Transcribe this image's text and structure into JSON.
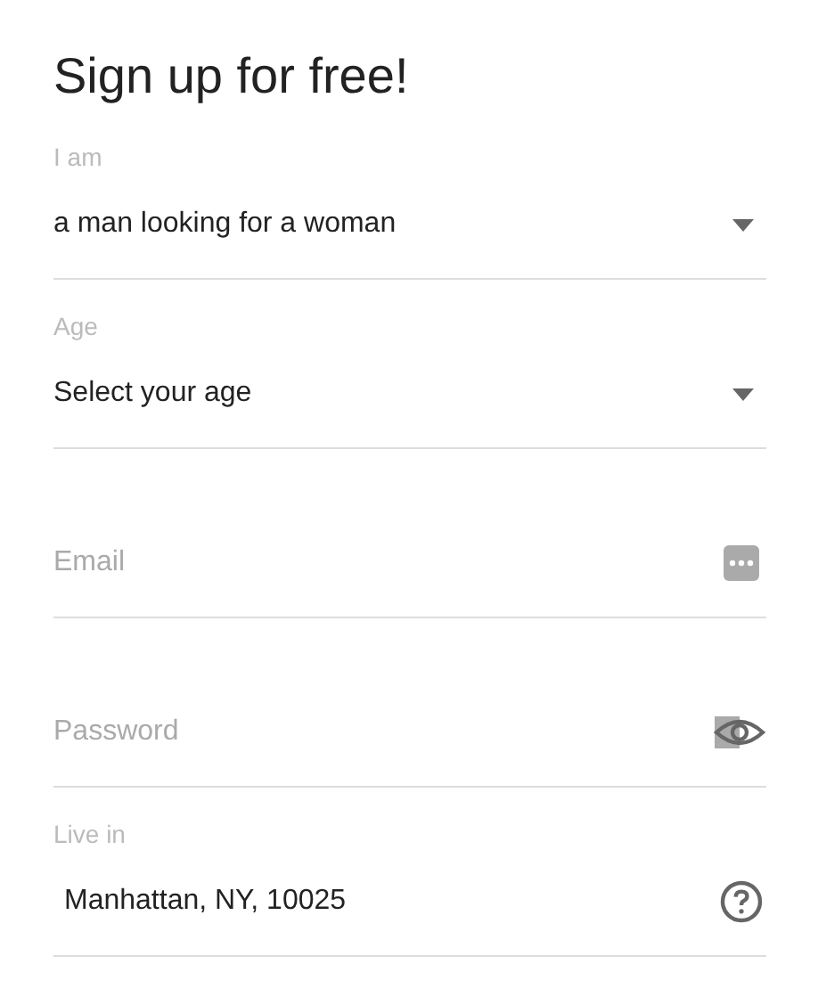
{
  "title": "Sign up for free!",
  "fields": [
    {
      "kind": "select",
      "label": "I am",
      "value": "a man looking for a woman"
    },
    {
      "kind": "select",
      "label": "Age",
      "value": "Select your age"
    },
    {
      "kind": "email",
      "placeholder": "Email"
    },
    {
      "kind": "password",
      "placeholder": "Password"
    },
    {
      "kind": "location",
      "label": "Live in",
      "value": "Manhattan, NY, 10025"
    }
  ]
}
